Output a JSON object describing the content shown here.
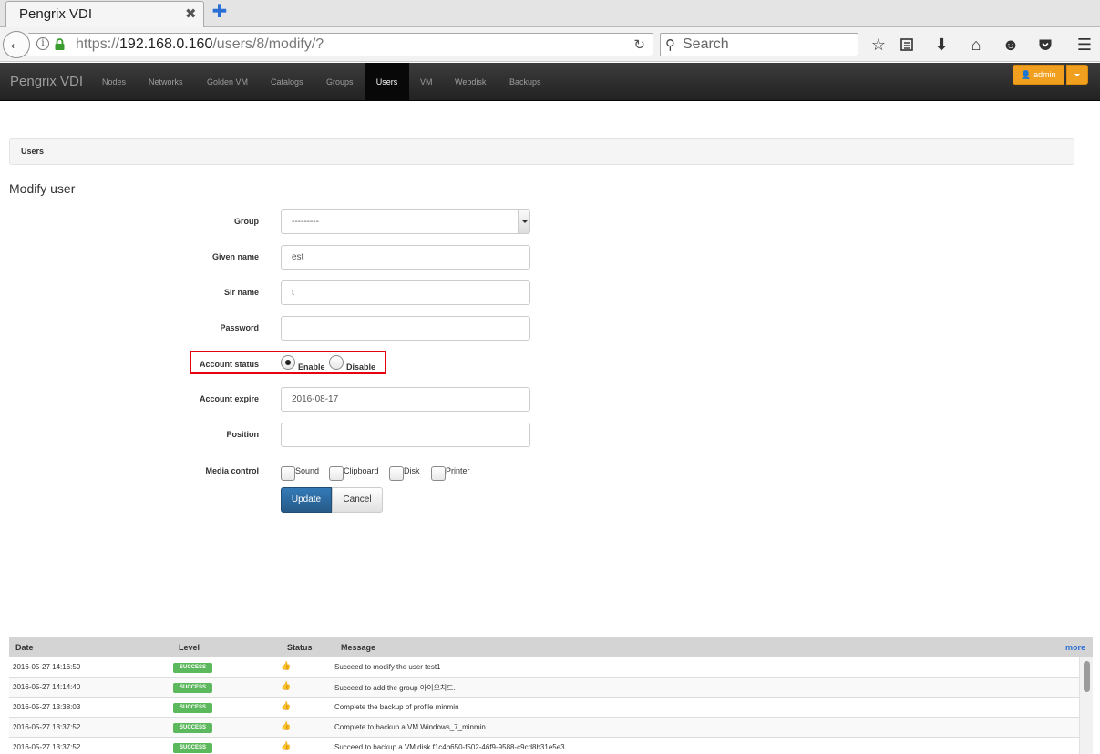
{
  "browser": {
    "tab_title": "Pengrix VDI",
    "tab_close": "✖",
    "new_tab": "✚",
    "url_prefix": "https://",
    "url_host": "192.168.0.160",
    "url_path": "/users/8/modify/?",
    "search_placeholder": "Search"
  },
  "navbar": {
    "brand": "Pengrix VDI",
    "links": [
      "Nodes",
      "Networks",
      "Golden VM",
      "Catalogs",
      "Groups",
      "Users",
      "VM",
      "Webdisk",
      "Backups"
    ],
    "active": "Users",
    "admin_label": "admin"
  },
  "page": {
    "breadcrumb": "Users",
    "title": "Modify user"
  },
  "form": {
    "group_label": "Group",
    "group_value": "---------",
    "given_name_label": "Given name",
    "given_name_value": "est",
    "sir_name_label": "Sir name",
    "sir_name_value": "t",
    "password_label": "Password",
    "password_value": "",
    "account_status_label": "Account status",
    "status_enable": "Enable",
    "status_disable": "Disable",
    "status_selected": "Enable",
    "account_expire_label": "Account expire",
    "account_expire_value": "2016-08-17",
    "position_label": "Position",
    "position_value": "",
    "media_control_label": "Media control",
    "media_options": [
      "Sound",
      "Clipboard",
      "Disk",
      "Printer"
    ],
    "update_label": "Update",
    "cancel_label": "Cancel"
  },
  "log": {
    "headers": [
      "Date",
      "Level",
      "Status",
      "Message"
    ],
    "more": "more",
    "rows": [
      {
        "date": "2016-05-27 14:16:59",
        "level": "SUCCESS",
        "message": "Succeed to modify the user test1"
      },
      {
        "date": "2016-05-27 14:14:40",
        "level": "SUCCESS",
        "message": "Succeed to add the group 아이오치드."
      },
      {
        "date": "2016-05-27 13:38:03",
        "level": "SUCCESS",
        "message": "Complete the backup of profile minmin"
      },
      {
        "date": "2016-05-27 13:37:52",
        "level": "SUCCESS",
        "message": "Complete to backup a VM Windows_7_minmin"
      },
      {
        "date": "2016-05-27 13:37:52",
        "level": "SUCCESS",
        "message": "Succeed to backup a VM disk f1c4b650-f502-46f9-9588-c9cd8b31e5e3"
      }
    ]
  },
  "colors": {
    "navbar": "#222222",
    "admin_button": "#f0a01e",
    "update_button": "#337ab7",
    "success_badge": "#5cb85c",
    "highlight": "#e3000f"
  }
}
